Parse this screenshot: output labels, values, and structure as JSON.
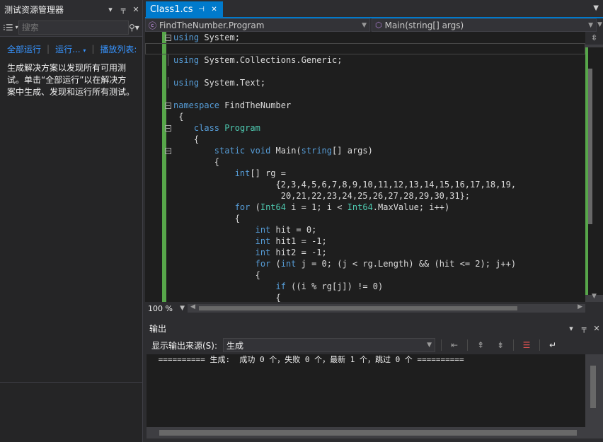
{
  "test_explorer": {
    "title": "测试资源管理器",
    "controls": [
      "▾",
      "╤",
      "✕"
    ],
    "search_placeholder": "搜索",
    "actions": {
      "run_all": "全部运行",
      "run": "运行...",
      "playlist": "播放列表:"
    },
    "message": "生成解决方案以发现所有可用测试。单击“全部运行”以在解决方案中生成、发现和运行所有测试。"
  },
  "editor": {
    "tab_label": "Class1.cs",
    "tab_icons": [
      "⊣",
      "✕"
    ],
    "nav_type": "FindTheNumber.Program",
    "nav_member": "Main(string[] args)",
    "zoom": "100 %",
    "lines": [
      {
        "fold": true,
        "parts": [
          [
            "kw",
            "using"
          ],
          [
            "t",
            " System;"
          ]
        ]
      },
      {
        "fold": false,
        "parts": []
      },
      {
        "fold": false,
        "vline": true,
        "parts": [
          [
            "kw",
            "using"
          ],
          [
            "t",
            " System.Collections.Generic;"
          ]
        ]
      },
      {
        "fold": false,
        "parts": []
      },
      {
        "fold": false,
        "vline": true,
        "parts": [
          [
            "kw",
            "using"
          ],
          [
            "t",
            " System.Text;"
          ]
        ]
      },
      {
        "fold": false,
        "parts": []
      },
      {
        "fold": true,
        "parts": [
          [
            "kw",
            "namespace"
          ],
          [
            "t",
            " FindTheNumber"
          ]
        ]
      },
      {
        "fold": false,
        "parts": [
          [
            "t",
            " {"
          ]
        ]
      },
      {
        "fold": true,
        "parts": [
          [
            "t",
            "    "
          ],
          [
            "kw",
            "class"
          ],
          [
            "t",
            " "
          ],
          [
            "ty",
            "Program"
          ]
        ]
      },
      {
        "fold": false,
        "parts": [
          [
            "t",
            "    {"
          ]
        ]
      },
      {
        "fold": true,
        "parts": [
          [
            "t",
            "        "
          ],
          [
            "kw",
            "static"
          ],
          [
            "t",
            " "
          ],
          [
            "kw",
            "void"
          ],
          [
            "t",
            " Main("
          ],
          [
            "kw",
            "string"
          ],
          [
            "t",
            "[] args)"
          ]
        ]
      },
      {
        "fold": false,
        "parts": [
          [
            "t",
            "        {"
          ]
        ]
      },
      {
        "fold": false,
        "parts": [
          [
            "t",
            "            "
          ],
          [
            "kw",
            "int"
          ],
          [
            "t",
            "[] rg ="
          ]
        ]
      },
      {
        "fold": false,
        "parts": [
          [
            "t",
            "                    {2,3,4,5,6,7,8,9,10,11,12,13,14,15,16,17,18,19,"
          ]
        ]
      },
      {
        "fold": false,
        "parts": [
          [
            "t",
            "                     20,21,22,23,24,25,26,27,28,29,30,31};"
          ]
        ]
      },
      {
        "fold": false,
        "parts": [
          [
            "t",
            "            "
          ],
          [
            "kw",
            "for"
          ],
          [
            "t",
            " ("
          ],
          [
            "ty",
            "Int64"
          ],
          [
            "t",
            " i = 1; i < "
          ],
          [
            "ty",
            "Int64"
          ],
          [
            "t",
            ".MaxValue; i++)"
          ]
        ]
      },
      {
        "fold": false,
        "parts": [
          [
            "t",
            "            {"
          ]
        ]
      },
      {
        "fold": false,
        "parts": [
          [
            "t",
            "                "
          ],
          [
            "kw",
            "int"
          ],
          [
            "t",
            " hit = 0;"
          ]
        ]
      },
      {
        "fold": false,
        "parts": [
          [
            "t",
            "                "
          ],
          [
            "kw",
            "int"
          ],
          [
            "t",
            " hit1 = -1;"
          ]
        ]
      },
      {
        "fold": false,
        "parts": [
          [
            "t",
            "                "
          ],
          [
            "kw",
            "int"
          ],
          [
            "t",
            " hit2 = -1;"
          ]
        ]
      },
      {
        "fold": false,
        "parts": [
          [
            "t",
            "                "
          ],
          [
            "kw",
            "for"
          ],
          [
            "t",
            " ("
          ],
          [
            "kw",
            "int"
          ],
          [
            "t",
            " j = 0; (j < rg.Length) && (hit <= 2); j++)"
          ]
        ]
      },
      {
        "fold": false,
        "parts": [
          [
            "t",
            "                {"
          ]
        ]
      },
      {
        "fold": false,
        "parts": [
          [
            "t",
            "                    "
          ],
          [
            "kw",
            "if"
          ],
          [
            "t",
            " ((i % rg[j]) != 0)"
          ]
        ]
      },
      {
        "fold": false,
        "parts": [
          [
            "t",
            "                    {"
          ]
        ]
      }
    ]
  },
  "output": {
    "title": "输出",
    "controls": [
      "▾",
      "╤",
      "✕"
    ],
    "source_label": "显示输出来源(S):",
    "source_value": "生成",
    "toolbar_icons": [
      "goto-prev-message-icon",
      "find-prev-icon",
      "find-next-icon",
      "clear-all-icon",
      "word-wrap-icon"
    ],
    "text": " ========== 生成:  成功 0 个，失败 0 个，最新 1 个，跳过 0 个 =========="
  }
}
